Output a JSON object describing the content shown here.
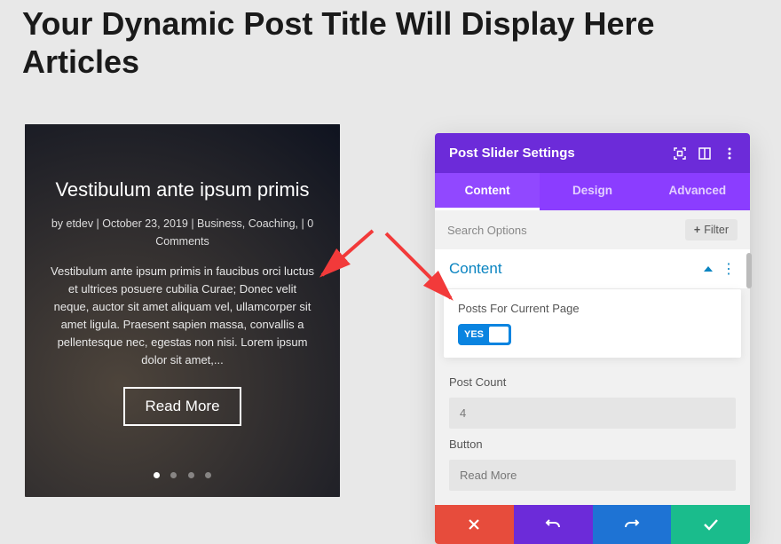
{
  "page": {
    "title": "Your Dynamic Post Title Will Display Here Articles"
  },
  "slider": {
    "post_title": "Vestibulum ante ipsum primis",
    "meta": "by etdev | October 23, 2019 | Business, Coaching, | 0 Comments",
    "excerpt": "Vestibulum ante ipsum primis in faucibus orci luctus et ultrices posuere cubilia Curae; Donec velit neque, auctor sit amet aliquam vel, ullamcorper sit amet ligula. Praesent sapien massa, convallis a pellentesque nec, egestas non nisi. Lorem ipsum dolor sit amet,...",
    "read_more_label": "Read More",
    "dot_count": 4,
    "active_dot": 0
  },
  "panel": {
    "title": "Post Slider Settings",
    "tabs": {
      "content": "Content",
      "design": "Design",
      "advanced": "Advanced"
    },
    "search_placeholder": "Search Options",
    "filter_label": "Filter",
    "section_title": "Content",
    "fields": {
      "current_page_label": "Posts For Current Page",
      "current_page_value": "YES",
      "post_count_label": "Post Count",
      "post_count_value": "4",
      "button_label": "Button",
      "button_value": "Read More"
    }
  },
  "colors": {
    "purple_dark": "#6c2bd9",
    "purple_light": "#8b3dff",
    "blue_link": "#0a84c1",
    "toggle_blue": "#0a84e0",
    "red": "#e74c3c",
    "footer_blue": "#1e73d4",
    "green": "#1abc8c",
    "arrow_red": "#f23a3a"
  }
}
